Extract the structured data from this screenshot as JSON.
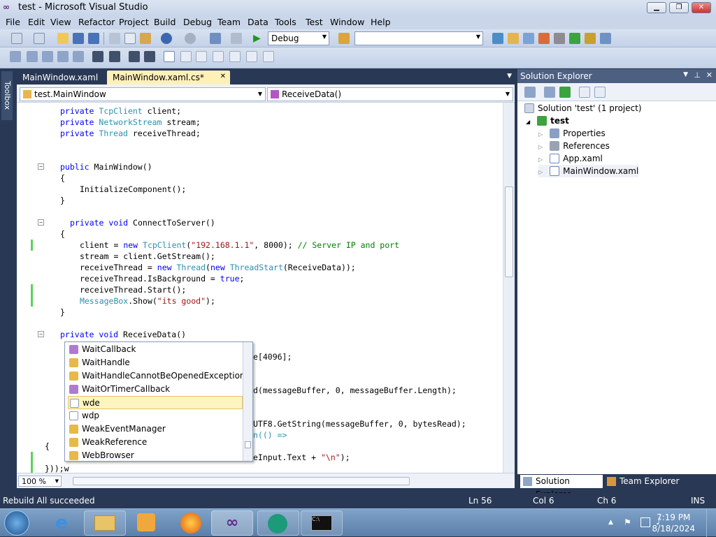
{
  "window": {
    "title": "test - Microsoft Visual Studio"
  },
  "menu": [
    "File",
    "Edit",
    "View",
    "Refactor",
    "Project",
    "Build",
    "Debug",
    "Team",
    "Data",
    "Tools",
    "Test",
    "Window",
    "Help"
  ],
  "toolbar": {
    "config": "Debug",
    "platform": ""
  },
  "tabs": [
    {
      "label": "MainWindow.xaml"
    },
    {
      "label": "MainWindow.xaml.cs*"
    }
  ],
  "toolbox": {
    "label": "Toolbox"
  },
  "nav": {
    "class": "test.MainWindow",
    "member": "ReceiveData()"
  },
  "code": {
    "l1": "    private TcpClient client;",
    "l2": "    private NetworkStream stream;",
    "l3": "    private Thread receiveThread;",
    "l4": "    public MainWindow()",
    "l5": "    {",
    "l6": "        InitializeComponent();",
    "l7": "    }",
    "l8": "      private void ConnectToServer()",
    "l9": "    {",
    "l10": "        client = new TcpClient(\"192.168.1.1\", 8000); // Server IP and port",
    "l11": "        stream = client.GetStream();",
    "l12": "        receiveThread = new Thread(new ThreadStart(ReceiveData));",
    "l13": "        receiveThread.IsBackground = true;",
    "l14": "        receiveThread.Start();",
    "l15": "        MessageBox.Show(\"its good\");",
    "l16": "    }",
    "l17": "    private void ReceiveData()",
    "l18": "e[4096];",
    "l19": "d(messageBuffer, 0, messageBuffer.Length);",
    "l20": "UTF8.GetString(messageBuffer, 0, bytesRead);",
    "l21": "n(() =>",
    "l22": "{",
    "l23": "eInput.Text + \"\\n\");",
    "l24": "}));w"
  },
  "intellisense": {
    "items": [
      "WaitCallback",
      "WaitHandle",
      "WaitHandleCannotBeOpenedException",
      "WaitOrTimerCallback",
      "wde",
      "wdp",
      "WeakEventManager",
      "WeakReference",
      "WebBrowser"
    ],
    "selected": 4
  },
  "zoom": "100 %",
  "solution_explorer": {
    "title": "Solution Explorer",
    "solution": "Solution 'test' (1 project)",
    "project": "test",
    "items": [
      "Properties",
      "References",
      "App.xaml",
      "MainWindow.xaml"
    ]
  },
  "bottom_tabs": [
    "Solution Explorer",
    "Team Explorer"
  ],
  "status": {
    "message": "Rebuild All succeeded",
    "ln": "Ln 56",
    "col": "Col 6",
    "ch": "Ch 6",
    "mode": "INS"
  },
  "clock": {
    "time": "7:19 PM",
    "date": "8/18/2024"
  }
}
